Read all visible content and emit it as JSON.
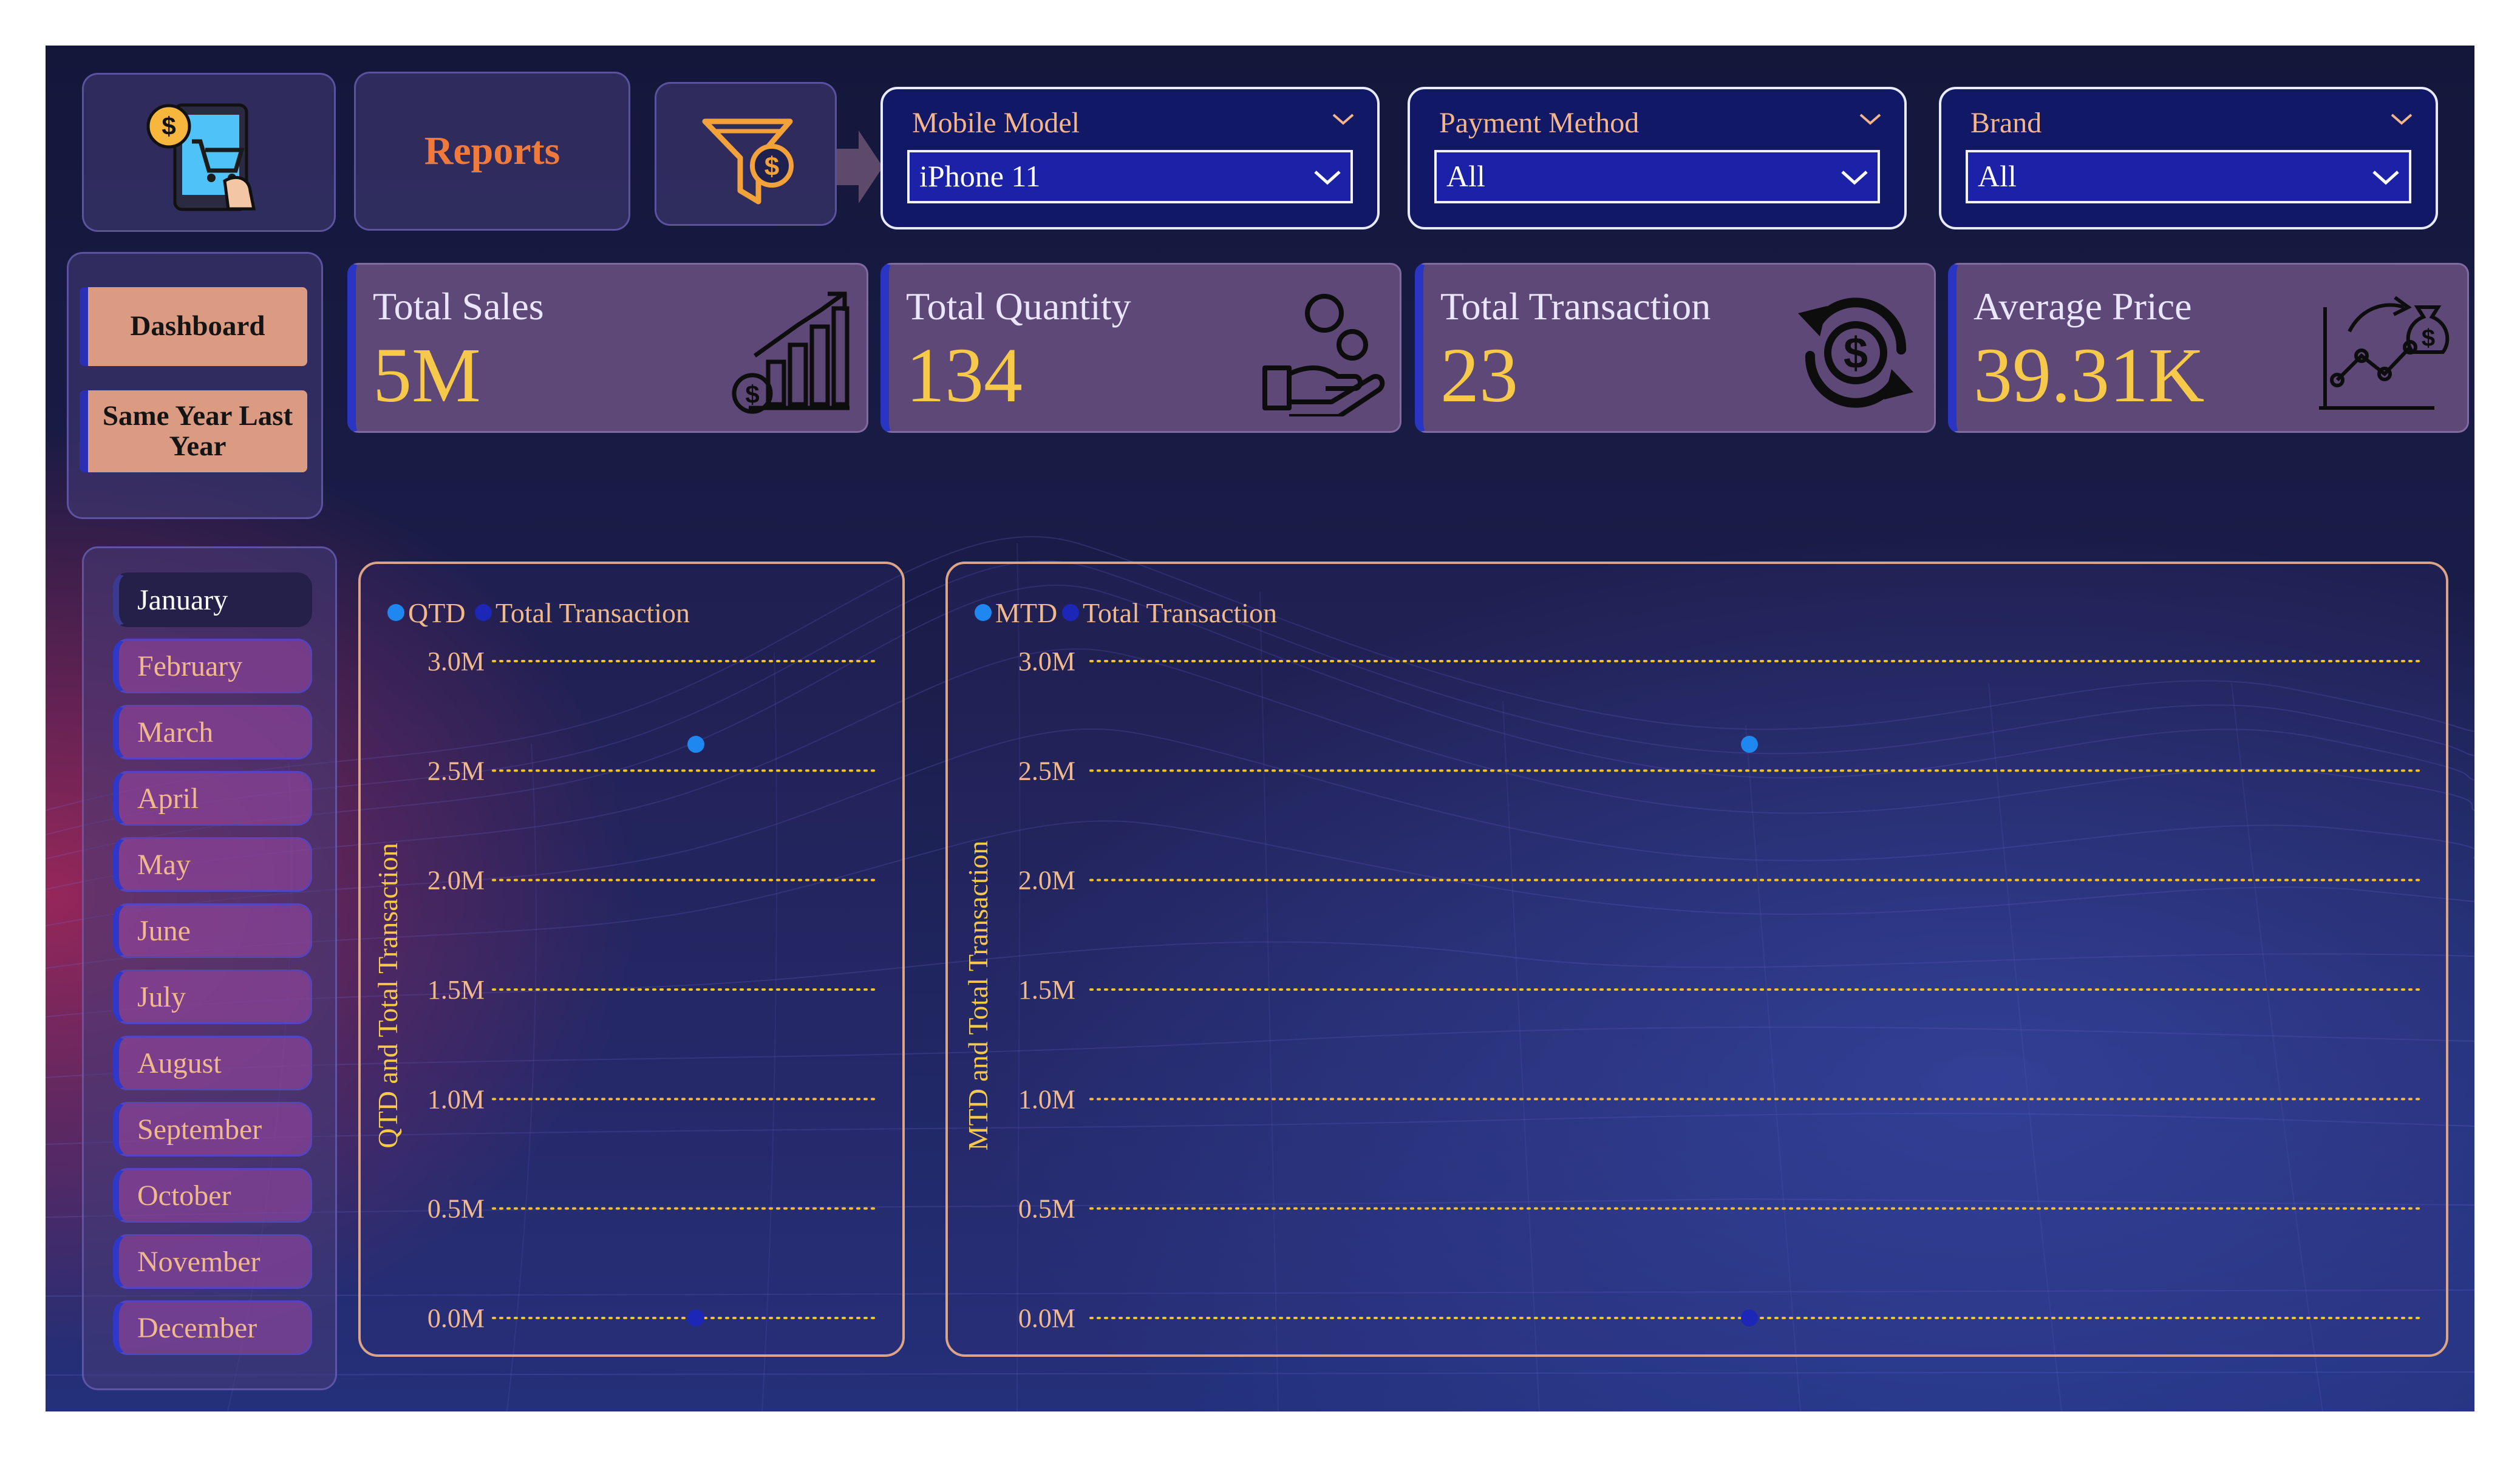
{
  "header": {
    "reports_label": "Reports",
    "logo_icon": "mobile-shopping-dollar-icon",
    "filter_icon": "filter-dollar-icon"
  },
  "slicers": [
    {
      "title": "Mobile Model",
      "value": "iPhone 11"
    },
    {
      "title": "Payment Method",
      "value": "All"
    },
    {
      "title": "Brand",
      "value": "All"
    }
  ],
  "nav": {
    "dashboard_label": "Dashboard",
    "same_year_label": "Same Year Last Year"
  },
  "kpis": [
    {
      "label": "Total Sales",
      "value": "5M",
      "icon": "bar-chart-growth-icon"
    },
    {
      "label": "Total Quantity",
      "value": "134",
      "icon": "hand-coins-icon"
    },
    {
      "label": "Total Transaction",
      "value": "23",
      "icon": "dollar-cycle-icon"
    },
    {
      "label": "Average Price",
      "value": "39.31K",
      "icon": "money-bag-chart-icon"
    }
  ],
  "months": {
    "items": [
      "January",
      "February",
      "March",
      "April",
      "May",
      "June",
      "July",
      "August",
      "September",
      "October",
      "November",
      "December"
    ],
    "selected": "January"
  },
  "colors": {
    "series_primary": "#1f87f0",
    "series_secondary": "#1c27b8",
    "gridline": "#f2c230",
    "tick_label": "#f0b88d",
    "axis_label": "#f6c94a"
  },
  "chart_data": [
    {
      "type": "scatter",
      "ylabel": "QTD and Total Transaction",
      "ylim": [
        0,
        3000000
      ],
      "yticks": [
        "0.0M",
        "0.5M",
        "1.0M",
        "1.5M",
        "2.0M",
        "2.5M",
        "3.0M"
      ],
      "grid": true,
      "legend_position": "top-left",
      "series": [
        {
          "name": "QTD",
          "values": [
            2620000
          ]
        },
        {
          "name": "Total Transaction",
          "values": [
            23
          ]
        }
      ]
    },
    {
      "type": "scatter",
      "ylabel": "MTD and Total Transaction",
      "ylim": [
        0,
        3000000
      ],
      "yticks": [
        "0.0M",
        "0.5M",
        "1.0M",
        "1.5M",
        "2.0M",
        "2.5M",
        "3.0M"
      ],
      "grid": true,
      "legend_position": "top-left",
      "series": [
        {
          "name": "MTD",
          "values": [
            2620000
          ]
        },
        {
          "name": "Total Transaction",
          "values": [
            23
          ]
        }
      ]
    }
  ]
}
